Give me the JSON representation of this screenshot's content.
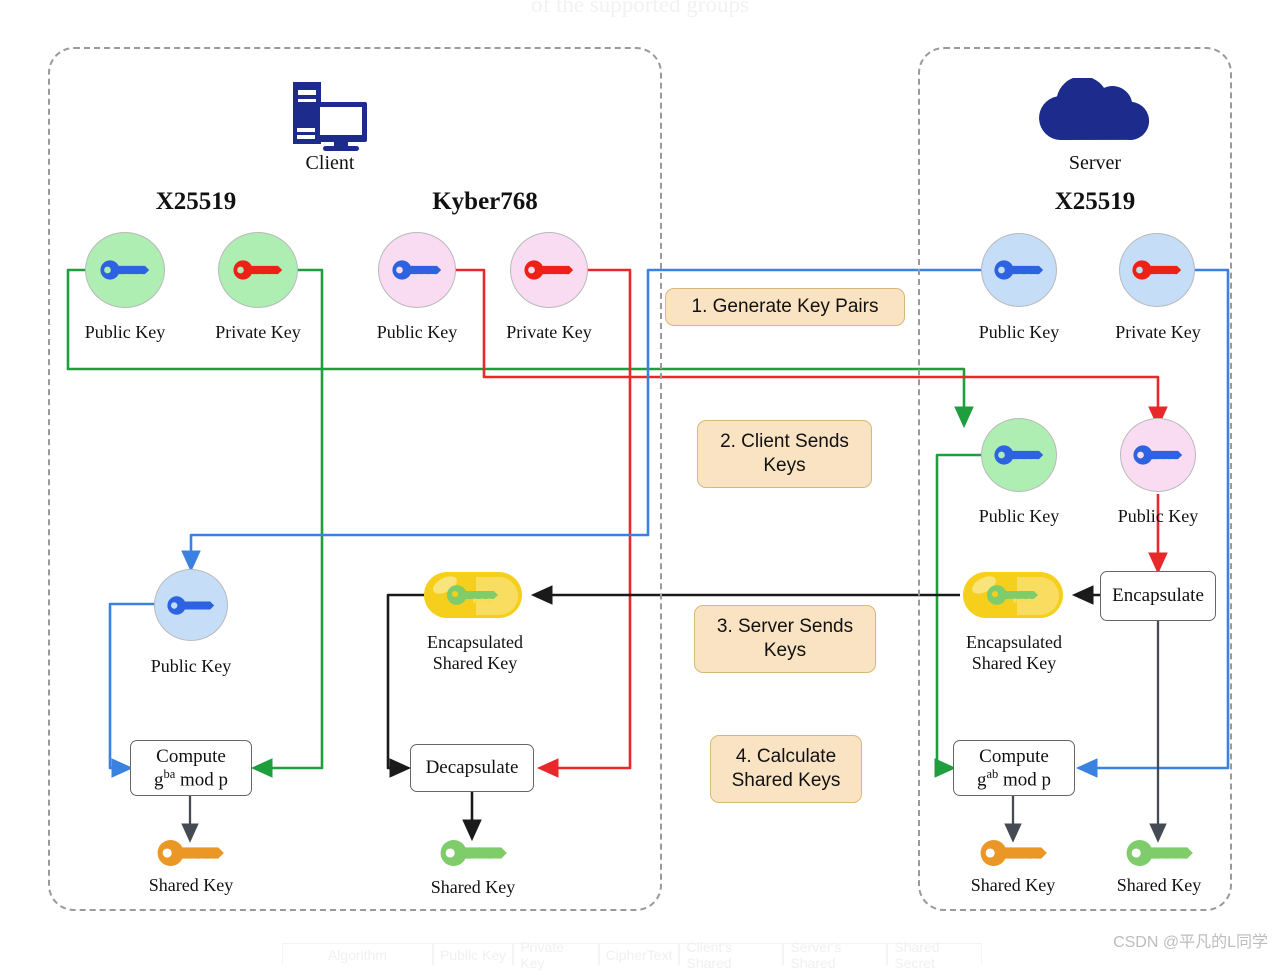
{
  "ghost_top_text": "of the supported groups",
  "watermark": "CSDN @平凡的L同学",
  "colors": {
    "green_wire": "#1f9e3d",
    "red_wire": "#e8282a",
    "blue_wire": "#3b82e0",
    "black_wire": "#1a1a1a",
    "gray_arrow": "#444b52",
    "circle_green": "#aeeeb3",
    "circle_pink": "#f9dcf2",
    "circle_blue": "#c5ddf7",
    "key_blue": "#2d62e0",
    "key_red": "#ee2116",
    "key_orange": "#eb9725",
    "key_green": "#7fcc6b",
    "capsule_yellow": "#f5cf1c",
    "step_fill": "#fae3c3",
    "step_border": "#d8b877",
    "device_navy": "#1c2b8c"
  },
  "client": {
    "device_label": "Client",
    "device_icon": "desktop-computer-icon",
    "algorithms": [
      {
        "name": "X25519"
      },
      {
        "name": "Kyber768"
      }
    ],
    "x25519": {
      "public_key_label": "Public Key",
      "private_key_label": "Private Key",
      "received_public_key_label": "Public Key",
      "compute_line1": "Compute",
      "compute_base": "g",
      "compute_exp": "ba",
      "compute_tail": " mod p",
      "shared_key_label": "Shared Key"
    },
    "kyber768": {
      "public_key_label": "Public Key",
      "private_key_label": "Private Key",
      "encapsulated_label_line1": "Encapsulated",
      "encapsulated_label_line2": "Shared Key",
      "decapsulate_label": "Decapsulate",
      "shared_key_label": "Shared Key"
    }
  },
  "server": {
    "device_label": "Server",
    "device_icon": "cloud-icon",
    "algorithm": "X25519",
    "public_key_label": "Public Key",
    "private_key_label": "Private Key",
    "received_x25519_public_key_label": "Public Key",
    "received_kyber_public_key_label": "Public Key",
    "encapsulate_label": "Encapsulate",
    "encapsulated_label_line1": "Encapsulated",
    "encapsulated_label_line2": "Shared Key",
    "compute_line1": "Compute",
    "compute_base": "g",
    "compute_exp": "ab",
    "compute_tail": " mod p",
    "shared_key_x25519_label": "Shared Key",
    "shared_key_kyber_label": "Shared Key"
  },
  "steps": [
    {
      "label": "1. Generate Key Pairs"
    },
    {
      "label": "2. Client Sends\nKeys"
    },
    {
      "label": "3. Server Sends\nKeys"
    },
    {
      "label": "4. Calculate\nShared Keys"
    }
  ],
  "ghost_table_headers": [
    "Algorithm",
    "Public Key",
    "Private Key",
    "CipherText",
    "Client's Shared",
    "Server's Shared",
    "Shared Secret"
  ]
}
